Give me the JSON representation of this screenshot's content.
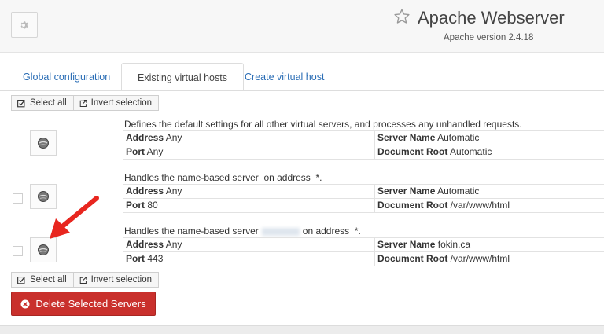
{
  "header": {
    "title": "Apache Webserver",
    "subtitle": "Apache version 2.4.18",
    "icons": {
      "settings": "gear-icon",
      "favorite": "star-icon"
    }
  },
  "tabs": [
    {
      "label": "Global configuration",
      "active": false
    },
    {
      "label": "Existing virtual hosts",
      "active": true
    },
    {
      "label": "Create virtual host",
      "active": false
    }
  ],
  "toolbar": {
    "select_all": "Select all",
    "invert_selection": "Invert selection"
  },
  "servers": [
    {
      "description": "Defines the default settings for all other virtual servers, and processes any unhandled requests.",
      "address_label": "Address",
      "address": "Any",
      "port_label": "Port",
      "port": "Any",
      "server_name_label": "Server Name",
      "server_name": "Automatic",
      "docroot_label": "Document Root",
      "docroot": "Automatic"
    },
    {
      "description_prefix": "Handles the name-based server",
      "description_suffix": "on address",
      "description_end": "*.",
      "address_label": "Address",
      "address": "Any",
      "port_label": "Port",
      "port": "80",
      "server_name_label": "Server Name",
      "server_name": "Automatic",
      "docroot_label": "Document Root",
      "docroot": "/var/www/html"
    },
    {
      "description_prefix": "Handles the name-based server",
      "description_suffix": "on address",
      "description_end": "*.",
      "address_label": "Address",
      "address": "Any",
      "port_label": "Port",
      "port": "443",
      "server_name_label": "Server Name",
      "server_name": "fokin.ca",
      "docroot_label": "Document Root",
      "docroot": "/var/www/html"
    }
  ],
  "delete_button": "Delete Selected Servers",
  "colors": {
    "link": "#2a6db5",
    "danger": "#c9302c",
    "annotation": "#e8261f"
  }
}
